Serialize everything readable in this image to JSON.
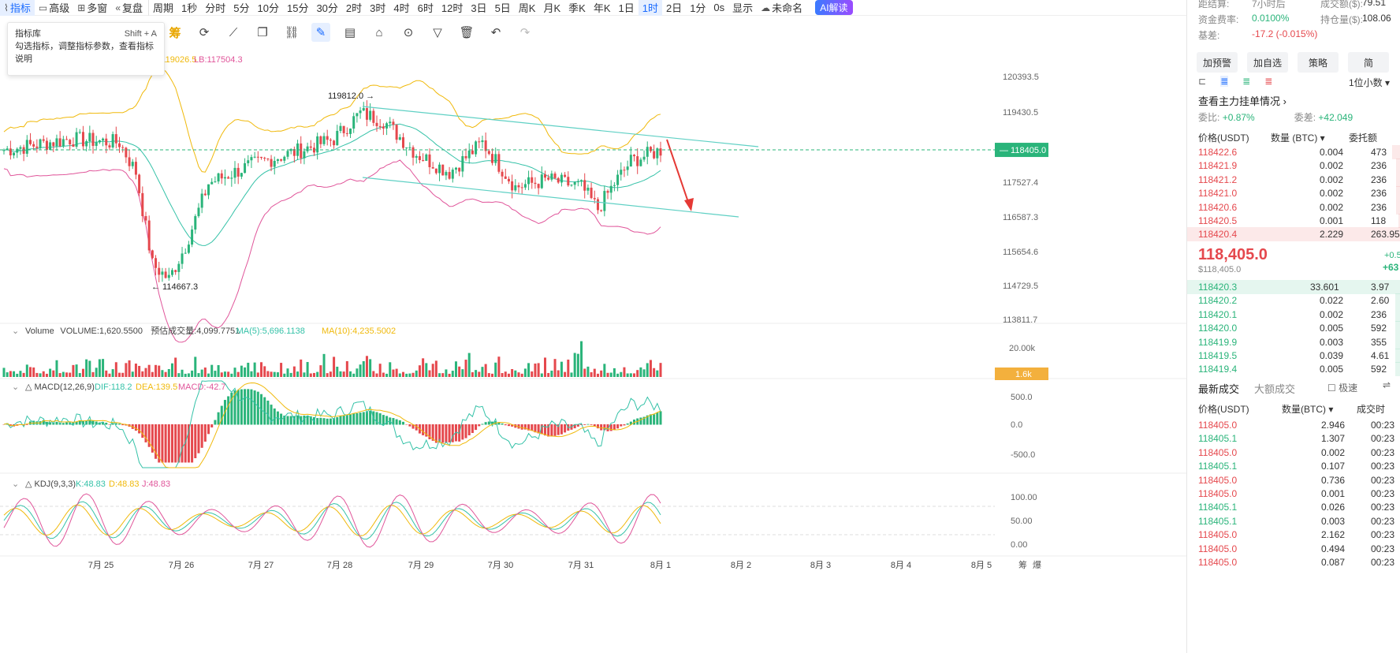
{
  "toolbar": {
    "items": [
      "指标",
      "高级",
      "多窗",
      "复盘",
      "周期",
      "1秒",
      "分时",
      "5分",
      "10分",
      "15分",
      "30分",
      "2时",
      "3时",
      "4时",
      "6时",
      "12时",
      "3日",
      "5日",
      "周K",
      "月K",
      "季K",
      "年K",
      "1日",
      "1时",
      "2日",
      "1分",
      "0s",
      "显示",
      "未命名",
      "AI解读"
    ],
    "active": "1时"
  },
  "tooltip": {
    "title": "指标库",
    "shortcut": "Shift + A",
    "desc": "勾选指标，调整指标参数，查看指标说明"
  },
  "bb_legend": {
    "ub": "UB:119026.5",
    "lb": "LB:117504.3"
  },
  "price_axis": [
    "120393.5",
    "119430.5",
    "118405.0",
    "117527.4",
    "116587.3",
    "115654.6",
    "114729.5",
    "113811.7"
  ],
  "current_price": "118405.0",
  "annotations": {
    "high": "119812.0",
    "low": "114667.3"
  },
  "volume": {
    "title": "Volume",
    "value": "VOLUME:1,620.5500",
    "est": "预估成交量:4,099.7751",
    "ma5": "MA(5):5,696.1138",
    "ma10": "MA(10):4,235.5002",
    "axis_top": "20.00k",
    "tag": "1.6k"
  },
  "macd": {
    "title": "MACD(12,26,9)",
    "dif": "DIF:118.2",
    "dea": "DEA:139.5",
    "macd": "MACD:-42.7",
    "axis": [
      "500.0",
      "0.0",
      "-500.0"
    ]
  },
  "kdj": {
    "title": "KDJ(9,3,3)",
    "k": "K:48.83",
    "d": "D:48.83",
    "j": "J:48.83",
    "axis": [
      "100.00",
      "50.00",
      "0.00"
    ]
  },
  "dates": [
    "7月 25",
    "7月 26",
    "7月 27",
    "7月 28",
    "7月 29",
    "7月 30",
    "7月 31",
    "8月 1",
    "8月 2",
    "8月 3",
    "8月 4",
    "8月 5"
  ],
  "corner": [
    "筹",
    "爆"
  ],
  "right": {
    "info1": {
      "l": "距结算:",
      "lv": "7小时后",
      "r": "成交额($):",
      "rv": "79.51"
    },
    "info2": {
      "l": "资金费率:",
      "lv": "0.0100%",
      "r": "持仓量($):",
      "rv": "108.06"
    },
    "info3": {
      "l": "基差:",
      "lv": "-17.2 (-0.015%)"
    },
    "buttons": [
      "加预警",
      "加自选",
      "策略",
      "简"
    ],
    "decimal": "1位小数",
    "main_orders": "查看主力挂单情况",
    "ratio": {
      "l": "委比:",
      "lv": "+0.87%",
      "r": "委差:",
      "rv": "+42.049"
    },
    "ob_header": [
      "价格(USDT)",
      "数量 (BTC)",
      "委托额"
    ],
    "asks": [
      [
        "118422.6",
        "0.004",
        "473"
      ],
      [
        "118421.9",
        "0.002",
        "236"
      ],
      [
        "118421.2",
        "0.002",
        "236"
      ],
      [
        "118421.0",
        "0.002",
        "236"
      ],
      [
        "118420.6",
        "0.002",
        "236"
      ],
      [
        "118420.5",
        "0.001",
        "118"
      ],
      [
        "118420.4",
        "2.229",
        "263.95"
      ]
    ],
    "mid_price": "118,405.0",
    "mid_usd": "$118,405.0",
    "mid_r1": "+0.5",
    "mid_r2": "+63",
    "bids": [
      [
        "118420.3",
        "33.601",
        "3.97"
      ],
      [
        "118420.2",
        "0.022",
        "2.60"
      ],
      [
        "118420.1",
        "0.002",
        "236"
      ],
      [
        "118420.0",
        "0.005",
        "592"
      ],
      [
        "118419.9",
        "0.003",
        "355"
      ],
      [
        "118419.5",
        "0.039",
        "4.61"
      ],
      [
        "118419.4",
        "0.005",
        "592"
      ]
    ],
    "trade_tabs": [
      "最新成交",
      "大额成交"
    ],
    "speed": "极速",
    "trade_header": [
      "价格(USDT)",
      "数量(BTC)",
      "成交时"
    ],
    "trades": [
      [
        "118405.0",
        "2.946",
        "00:23",
        "r"
      ],
      [
        "118405.1",
        "1.307",
        "00:23",
        "g"
      ],
      [
        "118405.0",
        "0.002",
        "00:23",
        "r"
      ],
      [
        "118405.1",
        "0.107",
        "00:23",
        "g"
      ],
      [
        "118405.0",
        "0.736",
        "00:23",
        "r"
      ],
      [
        "118405.0",
        "0.001",
        "00:23",
        "r"
      ],
      [
        "118405.1",
        "0.026",
        "00:23",
        "g"
      ],
      [
        "118405.1",
        "0.003",
        "00:23",
        "g"
      ],
      [
        "118405.0",
        "2.162",
        "00:23",
        "r"
      ],
      [
        "118405.0",
        "0.494",
        "00:23",
        "r"
      ],
      [
        "118405.0",
        "0.087",
        "00:23",
        "r"
      ]
    ]
  },
  "colors": {
    "up": "#2ab47a",
    "down": "#e5484d",
    "ub": "#f0b90b",
    "mid": "#35c2a8",
    "lb": "#e0559a",
    "channel": "#5fd0c4",
    "accent": "#1a6bff"
  }
}
